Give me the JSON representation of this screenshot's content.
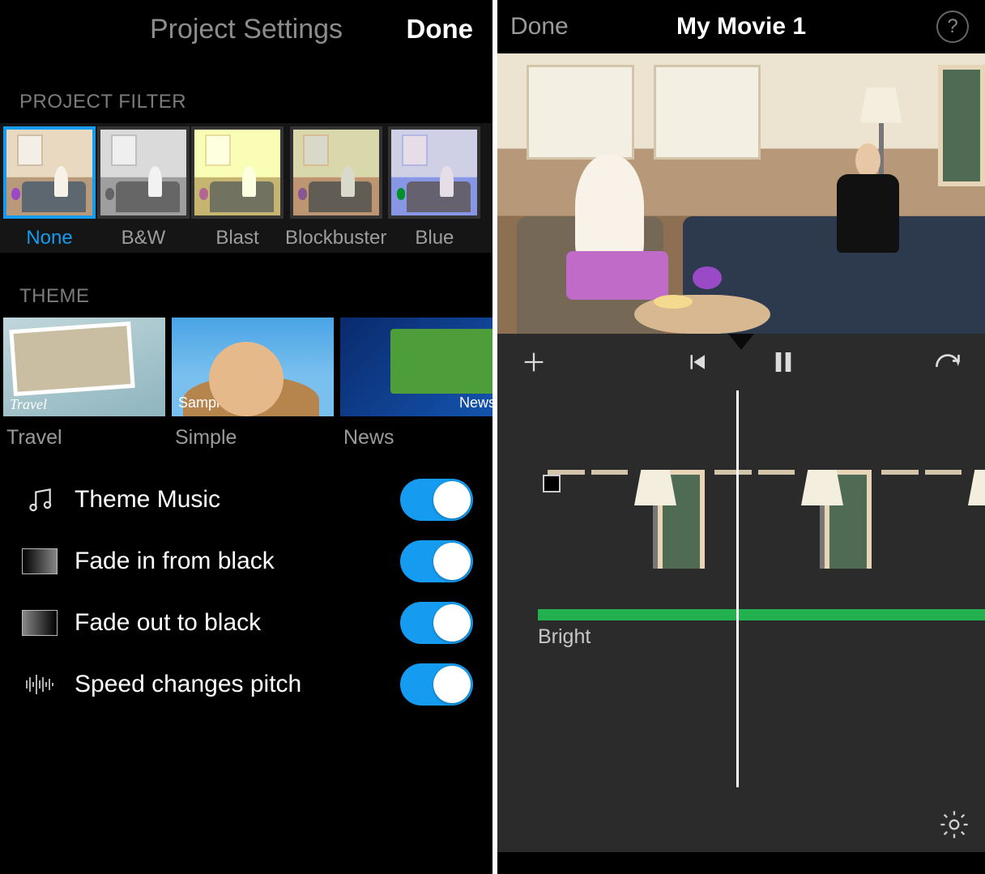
{
  "left": {
    "header": {
      "title": "Project Settings",
      "done": "Done"
    },
    "sections": {
      "filter_head": "PROJECT FILTER",
      "theme_head": "THEME"
    },
    "filters": [
      {
        "label": "None",
        "selected": true
      },
      {
        "label": "B&W",
        "selected": false
      },
      {
        "label": "Blast",
        "selected": false
      },
      {
        "label": "Blockbuster",
        "selected": false
      },
      {
        "label": "Blue",
        "selected": false
      }
    ],
    "themes": [
      {
        "title": "Travel",
        "corner_label": "Travel"
      },
      {
        "title": "Simple",
        "corner_label": "Sample"
      },
      {
        "title": "News",
        "corner_label": "News"
      }
    ],
    "settings": [
      {
        "label": "Theme Music",
        "on": true,
        "icon": "music"
      },
      {
        "label": "Fade in from black",
        "on": true,
        "icon": "fade-in"
      },
      {
        "label": "Fade out to black",
        "on": true,
        "icon": "fade-out"
      },
      {
        "label": "Speed changes pitch",
        "on": true,
        "icon": "waveform"
      }
    ]
  },
  "right": {
    "header": {
      "done": "Done",
      "title": "My Movie 1",
      "help_symbol": "?"
    },
    "toolbar_icons": {
      "add": "plus-icon",
      "prev": "previous-icon",
      "pause": "pause-icon",
      "undo": "undo-icon"
    },
    "audio_label": "Bright",
    "gear": "gear-icon"
  }
}
